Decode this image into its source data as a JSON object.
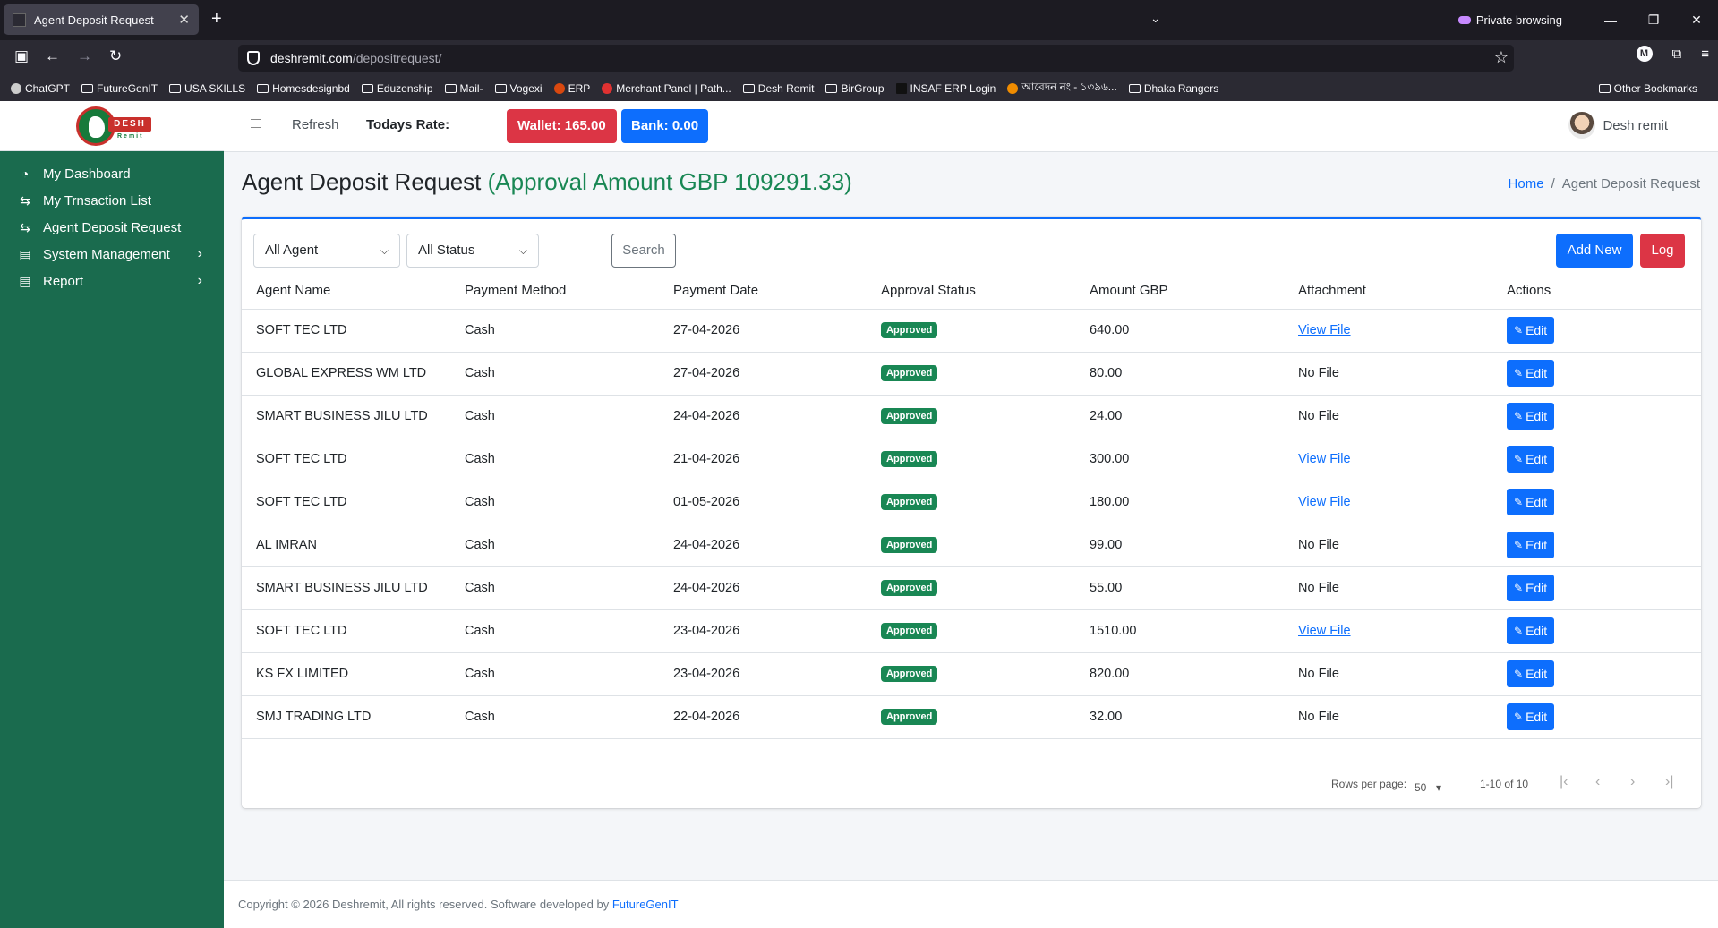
{
  "browser": {
    "tab_title": "Agent Deposit Request",
    "private_label": "Private browsing",
    "url_host": "deshremit.com",
    "url_path": "/depositrequest/",
    "bookmarks": [
      {
        "label": "ChatGPT",
        "icon": "chatgpt-icon"
      },
      {
        "label": "FutureGenIT",
        "icon": "folder-icon"
      },
      {
        "label": "USA SKILLS",
        "icon": "folder-icon"
      },
      {
        "label": "Homesdesignbd",
        "icon": "folder-icon"
      },
      {
        "label": "Eduzenship",
        "icon": "folder-icon"
      },
      {
        "label": "Mail-",
        "icon": "folder-icon"
      },
      {
        "label": "Vogexi",
        "icon": "folder-icon"
      },
      {
        "label": "ERP",
        "icon": "erp-icon"
      },
      {
        "label": "Merchant Panel | Path...",
        "icon": "pathao-icon"
      },
      {
        "label": "Desh Remit",
        "icon": "folder-icon"
      },
      {
        "label": "BirGroup",
        "icon": "folder-icon"
      },
      {
        "label": "INSAF ERP Login",
        "icon": "insaf-icon"
      },
      {
        "label": "আবেদন নং - ১৩৯৬...",
        "icon": "gov-icon"
      },
      {
        "label": "Dhaka Rangers",
        "icon": "folder-icon"
      }
    ],
    "other_bookmarks": "Other Bookmarks"
  },
  "logo": {
    "tag": "DESH",
    "sub": "Remit"
  },
  "sidebar": {
    "items": [
      {
        "label": "My Dashboard",
        "icon": "dashboard-icon"
      },
      {
        "label": "My Trnsaction List",
        "icon": "exchange-icon"
      },
      {
        "label": "Agent Deposit Request",
        "icon": "exchange-icon"
      },
      {
        "label": "System Management",
        "icon": "clipboard-icon"
      },
      {
        "label": "Report",
        "icon": "clipboard-icon"
      }
    ]
  },
  "topbar": {
    "refresh": "Refresh",
    "rate_label": "Todays Rate:",
    "wallet": "Wallet: 165.00",
    "bank": "Bank: 0.00",
    "user": "Desh remit"
  },
  "page": {
    "title": "Agent Deposit Request",
    "approval": "(Approval Amount GBP 109291.33)",
    "breadcrumb_home": "Home",
    "breadcrumb_sep": "/",
    "breadcrumb_current": "Agent Deposit Request"
  },
  "filters": {
    "agent": "All Agent",
    "status": "All Status",
    "search": "Search",
    "add_new": "Add New",
    "log": "Log"
  },
  "table": {
    "headers": [
      "Agent Name",
      "Payment Method",
      "Payment Date",
      "Approval Status",
      "Amount GBP",
      "Attachment",
      "Actions"
    ],
    "edit_label": "Edit",
    "rows": [
      {
        "agent": "SOFT TEC LTD",
        "method": "Cash",
        "date": "27-04-2026",
        "status": "Approved",
        "amount": "640.00",
        "attachment": "View File",
        "has_file": true
      },
      {
        "agent": "GLOBAL EXPRESS WM LTD",
        "method": "Cash",
        "date": "27-04-2026",
        "status": "Approved",
        "amount": "80.00",
        "attachment": "No File",
        "has_file": false
      },
      {
        "agent": "SMART BUSINESS JILU LTD",
        "method": "Cash",
        "date": "24-04-2026",
        "status": "Approved",
        "amount": "24.00",
        "attachment": "No File",
        "has_file": false
      },
      {
        "agent": "SOFT TEC LTD",
        "method": "Cash",
        "date": "21-04-2026",
        "status": "Approved",
        "amount": "300.00",
        "attachment": "View File",
        "has_file": true
      },
      {
        "agent": "SOFT TEC LTD",
        "method": "Cash",
        "date": "01-05-2026",
        "status": "Approved",
        "amount": "180.00",
        "attachment": "View File",
        "has_file": true
      },
      {
        "agent": "AL IMRAN",
        "method": "Cash",
        "date": "24-04-2026",
        "status": "Approved",
        "amount": "99.00",
        "attachment": "No File",
        "has_file": false
      },
      {
        "agent": "SMART BUSINESS JILU LTD",
        "method": "Cash",
        "date": "24-04-2026",
        "status": "Approved",
        "amount": "55.00",
        "attachment": "No File",
        "has_file": false
      },
      {
        "agent": "SOFT TEC LTD",
        "method": "Cash",
        "date": "23-04-2026",
        "status": "Approved",
        "amount": "1510.00",
        "attachment": "View File",
        "has_file": true
      },
      {
        "agent": "KS FX LIMITED",
        "method": "Cash",
        "date": "23-04-2026",
        "status": "Approved",
        "amount": "820.00",
        "attachment": "No File",
        "has_file": false
      },
      {
        "agent": "SMJ TRADING LTD",
        "method": "Cash",
        "date": "22-04-2026",
        "status": "Approved",
        "amount": "32.00",
        "attachment": "No File",
        "has_file": false
      }
    ]
  },
  "pagination": {
    "rows_label": "Rows per page:",
    "rows_value": "50",
    "range": "1-10 of 10"
  },
  "footer": {
    "text": "Copyright © 2026 Deshremit, All rights reserved. Software developed by",
    "developer": "FutureGenIT"
  }
}
